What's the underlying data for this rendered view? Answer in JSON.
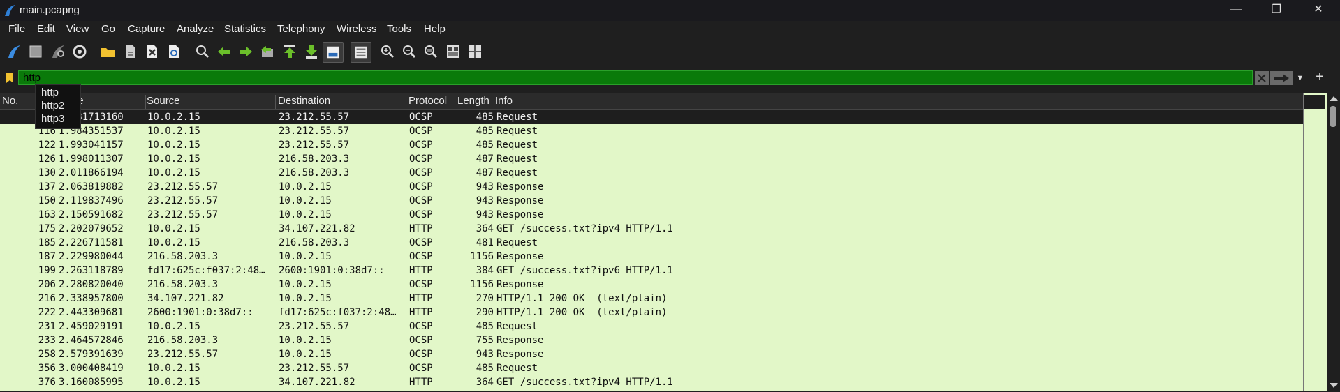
{
  "window": {
    "title": "main.pcapng",
    "minimize": "—",
    "maximize": "❐",
    "close": "✕"
  },
  "menu": [
    "File",
    "Edit",
    "View",
    "Go",
    "Capture",
    "Analyze",
    "Statistics",
    "Telephony",
    "Wireless",
    "Tools",
    "Help"
  ],
  "toolbar_icons": [
    "start-capture-icon",
    "stop-capture-icon",
    "restart-capture-icon",
    "capture-options-icon",
    "open-file-icon",
    "save-file-icon",
    "close-file-icon",
    "reload-file-icon",
    "find-packet-icon",
    "go-back-icon",
    "go-forward-icon",
    "go-to-packet-icon",
    "first-packet-icon",
    "last-packet-icon",
    "autoscroll-icon",
    "colorize-icon",
    "zoom-in-icon",
    "zoom-out-icon",
    "normal-size-icon",
    "resize-columns-icon",
    "layout-icon"
  ],
  "filter": {
    "value": "http"
  },
  "autocomplete": [
    "http",
    "http2",
    "http3"
  ],
  "columns": [
    "No.",
    "Time",
    "Source",
    "Destination",
    "Protocol",
    "Length",
    "Info"
  ],
  "packets": [
    {
      "no": "",
      "time": "1.981713160",
      "src": "10.0.2.15",
      "dst": "23.212.55.57",
      "proto": "OCSP",
      "len": "485",
      "info": "Request",
      "selected": true
    },
    {
      "no": "116",
      "time": "1.984351537",
      "src": "10.0.2.15",
      "dst": "23.212.55.57",
      "proto": "OCSP",
      "len": "485",
      "info": "Request"
    },
    {
      "no": "122",
      "time": "1.993041157",
      "src": "10.0.2.15",
      "dst": "23.212.55.57",
      "proto": "OCSP",
      "len": "485",
      "info": "Request"
    },
    {
      "no": "126",
      "time": "1.998011307",
      "src": "10.0.2.15",
      "dst": "216.58.203.3",
      "proto": "OCSP",
      "len": "487",
      "info": "Request"
    },
    {
      "no": "130",
      "time": "2.011866194",
      "src": "10.0.2.15",
      "dst": "216.58.203.3",
      "proto": "OCSP",
      "len": "487",
      "info": "Request"
    },
    {
      "no": "137",
      "time": "2.063819882",
      "src": "23.212.55.57",
      "dst": "10.0.2.15",
      "proto": "OCSP",
      "len": "943",
      "info": "Response"
    },
    {
      "no": "150",
      "time": "2.119837496",
      "src": "23.212.55.57",
      "dst": "10.0.2.15",
      "proto": "OCSP",
      "len": "943",
      "info": "Response"
    },
    {
      "no": "163",
      "time": "2.150591682",
      "src": "23.212.55.57",
      "dst": "10.0.2.15",
      "proto": "OCSP",
      "len": "943",
      "info": "Response"
    },
    {
      "no": "175",
      "time": "2.202079652",
      "src": "10.0.2.15",
      "dst": "34.107.221.82",
      "proto": "HTTP",
      "len": "364",
      "info": "GET /success.txt?ipv4 HTTP/1.1"
    },
    {
      "no": "185",
      "time": "2.226711581",
      "src": "10.0.2.15",
      "dst": "216.58.203.3",
      "proto": "OCSP",
      "len": "481",
      "info": "Request"
    },
    {
      "no": "187",
      "time": "2.229980044",
      "src": "216.58.203.3",
      "dst": "10.0.2.15",
      "proto": "OCSP",
      "len": "1156",
      "info": "Response"
    },
    {
      "no": "199",
      "time": "2.263118789",
      "src": "fd17:625c:f037:2:48…",
      "dst": "2600:1901:0:38d7::",
      "proto": "HTTP",
      "len": "384",
      "info": "GET /success.txt?ipv6 HTTP/1.1"
    },
    {
      "no": "206",
      "time": "2.280820040",
      "src": "216.58.203.3",
      "dst": "10.0.2.15",
      "proto": "OCSP",
      "len": "1156",
      "info": "Response"
    },
    {
      "no": "216",
      "time": "2.338957800",
      "src": "34.107.221.82",
      "dst": "10.0.2.15",
      "proto": "HTTP",
      "len": "270",
      "info": "HTTP/1.1 200 OK  (text/plain)"
    },
    {
      "no": "222",
      "time": "2.443309681",
      "src": "2600:1901:0:38d7::",
      "dst": "fd17:625c:f037:2:48…",
      "proto": "HTTP",
      "len": "290",
      "info": "HTTP/1.1 200 OK  (text/plain)"
    },
    {
      "no": "231",
      "time": "2.459029191",
      "src": "10.0.2.15",
      "dst": "23.212.55.57",
      "proto": "OCSP",
      "len": "485",
      "info": "Request"
    },
    {
      "no": "233",
      "time": "2.464572846",
      "src": "216.58.203.3",
      "dst": "10.0.2.15",
      "proto": "OCSP",
      "len": "755",
      "info": "Response"
    },
    {
      "no": "258",
      "time": "2.579391639",
      "src": "23.212.55.57",
      "dst": "10.0.2.15",
      "proto": "OCSP",
      "len": "943",
      "info": "Response"
    },
    {
      "no": "356",
      "time": "3.000408419",
      "src": "10.0.2.15",
      "dst": "23.212.55.57",
      "proto": "OCSP",
      "len": "485",
      "info": "Request"
    },
    {
      "no": "376",
      "time": "3.160085995",
      "src": "10.0.2.15",
      "dst": "34.107.221.82",
      "proto": "HTTP",
      "len": "364",
      "info": "GET /success.txt?ipv4 HTTP/1.1"
    }
  ],
  "colors": {
    "filter_valid": "#0a7a0a",
    "row_bg": "#e2f7c8",
    "selected_bg": "#1e1e1e"
  }
}
